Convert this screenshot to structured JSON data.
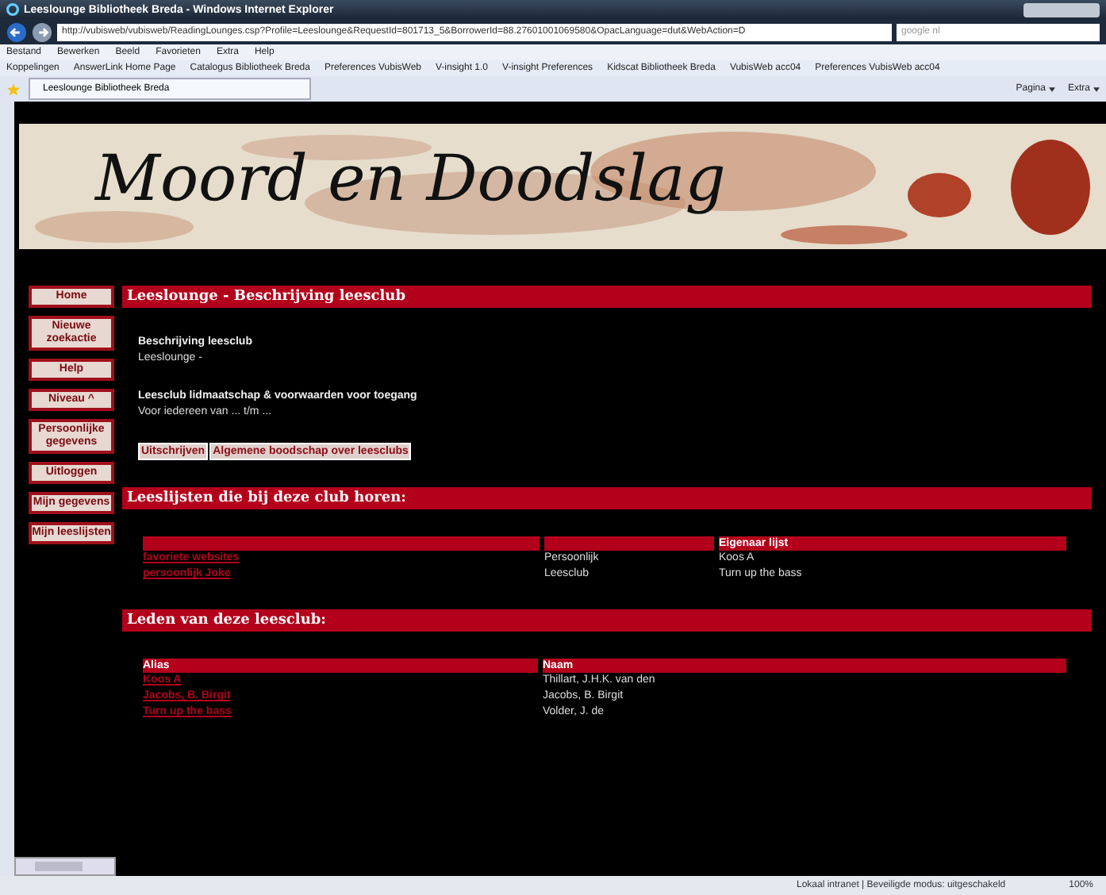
{
  "window": {
    "title": "Leeslounge Bibliotheek Breda - Windows Internet Explorer"
  },
  "address_bar": {
    "url": "http://vubisweb/vubisweb/ReadingLounges.csp?Profile=Leeslounge&RequestId=801713_5&BorrowerId=88.27601001069580&OpacLanguage=dut&WebAction=D",
    "search_placeholder": "google nl"
  },
  "menu_bar": [
    "Bestand",
    "Bewerken",
    "Beeld",
    "Favorieten",
    "Extra",
    "Help"
  ],
  "favorites_bar": {
    "label": "Koppelingen",
    "links": [
      "AnswerLink Home Page",
      "Catalogus Bibliotheek Breda",
      "Preferences VubisWeb",
      "V-insight 1.0",
      "V-insight Preferences",
      "Kidscat Bibliotheek Breda",
      "VubisWeb acc04",
      "Preferences VubisWeb acc04"
    ]
  },
  "tab": {
    "title": "Leeslounge Bibliotheek Breda"
  },
  "command_bar": [
    "Pagina",
    "Extra"
  ],
  "banner": {
    "title": "Moord en Doodslag"
  },
  "sidebar": {
    "items": [
      "Home",
      "Nieuwe zoekactie",
      "Help",
      "Niveau ^",
      "Persoonlijke gegevens",
      "Uitloggen",
      "Mijn gegevens",
      "Mijn leeslijsten"
    ]
  },
  "description": {
    "heading": "Leeslounge - Beschrijving leesclub",
    "blocks": [
      {
        "title": "Beschrijving leesclub",
        "text": "Leeslounge -"
      },
      {
        "title": "Leesclub lidmaatschap & voorwaarden voor toegang",
        "text": "Voor iedereen van ... t/m ..."
      }
    ],
    "buttons": [
      "Uitschrijven",
      "Algemene boodschap over leesclubs"
    ]
  },
  "reading_lists": {
    "heading": "Leeslijsten die bij deze club horen:",
    "columns": [
      "",
      "",
      "Eigenaar lijst"
    ],
    "rows": [
      [
        "favoriete websites",
        "Persoonlijk",
        "Koos A"
      ],
      [
        "persoonlijk Joke",
        "Leesclub",
        "Turn up the bass"
      ]
    ]
  },
  "members": {
    "heading": "Leden van deze leesclub:",
    "columns": [
      "Alias",
      "Naam"
    ],
    "rows": [
      [
        "Koos A",
        "Thillart, J.H.K. van den"
      ],
      [
        "Jacobs, B. Birgit",
        "Jacobs, B. Birgit"
      ],
      [
        "Turn up the bass",
        "Volder, J. de"
      ]
    ]
  },
  "status_bar": {
    "zone": "Lokaal intranet | Beveiligde modus: uitgeschakeld",
    "zoom": "100%"
  }
}
